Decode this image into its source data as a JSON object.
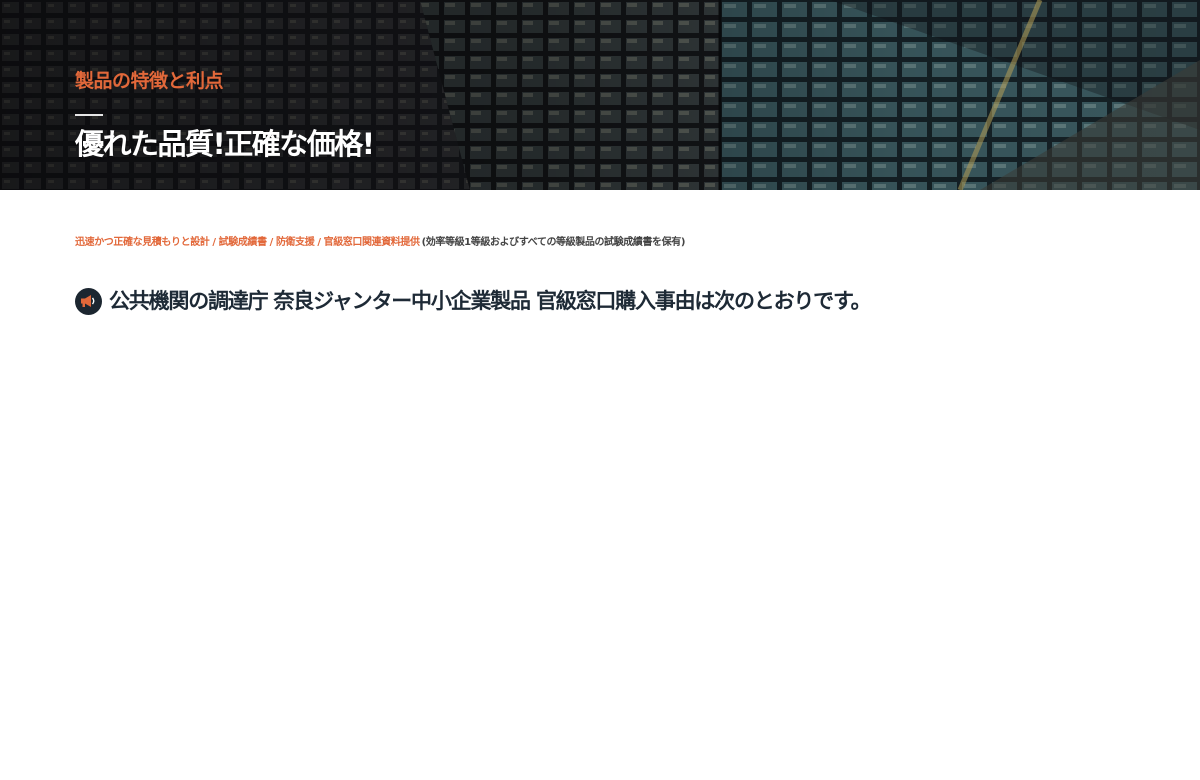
{
  "colors": {
    "accent": "#e2683a",
    "hero_bg": "#16171c",
    "heading_text": "#1e2a36",
    "icon_bg": "#1c2630"
  },
  "hero": {
    "subtitle": "製品の特徴と利点",
    "title": "優れた品質!正確な価格!"
  },
  "services": {
    "items": [
      "迅速かつ正確な見積もりと設計",
      "試験成績書",
      "防衛支援",
      "官級窓口関連資料提供"
    ],
    "separator": "/",
    "note": "(効率等級1等級およびすべての等級製品の試験成績書を保有)"
  },
  "reason": {
    "icon": "megaphone-icon",
    "heading": "公共機関の調達庁 奈良ジャンター中小企業製品 官級窓口購入事由は次のとおりです。"
  }
}
